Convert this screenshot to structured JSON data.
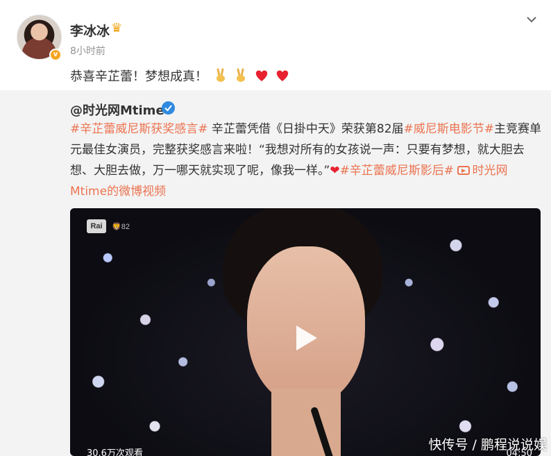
{
  "post": {
    "author": "李冰冰",
    "time": "8小时前",
    "text": "恭喜辛芷蕾！梦想成真！",
    "emojis": [
      "victory-hand",
      "victory-hand",
      "red-heart",
      "red-heart"
    ]
  },
  "repost": {
    "author": "@时光网Mtime",
    "body": [
      {
        "type": "tag",
        "text": "#辛芷蕾威尼斯获奖感言#"
      },
      {
        "type": "text",
        "text": " 辛芷蕾凭借《日掛中天》荣获第82届"
      },
      {
        "type": "tag",
        "text": "#威尼斯电影节#"
      },
      {
        "type": "text",
        "text": "主竞赛单元最佳女演员，完整获奖感言来啦！“我想对所有的女孩说一声：只要有梦想，就大胆去想、大胆去做，万一哪天就实现了呢，像我一样。”"
      },
      {
        "type": "heart",
        "text": "❤"
      },
      {
        "type": "tag",
        "text": "#辛芷蕾威尼斯影后#"
      },
      {
        "type": "text",
        "text": " "
      },
      {
        "type": "video-link",
        "text": "时光网Mtime的微博视频"
      }
    ]
  },
  "video": {
    "channel_logo": "Rai",
    "festival_logo": "82",
    "view_count": "30.6万次观看",
    "duration": "04:50"
  },
  "watermark": "快传号 / 鹏程说说娱",
  "colors": {
    "tag": "#eb7350",
    "heart": "#e8212f",
    "verified_personal": "#f6a623",
    "verified_org": "#2f8ae0"
  }
}
